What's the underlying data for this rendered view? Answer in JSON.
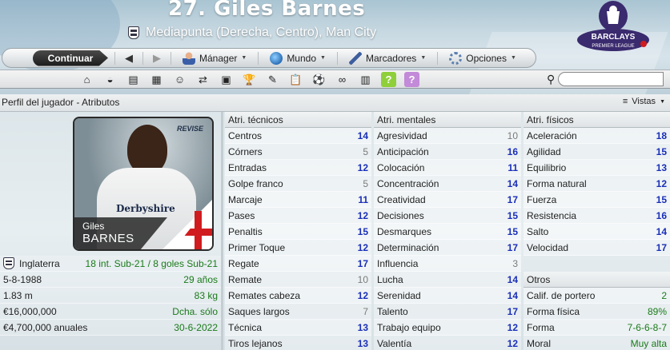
{
  "colors": {
    "value_blue": "#1a2fb8",
    "value_gray": "#7a7a7a",
    "value_green": "#1a7a1a",
    "header_text": "#ffffff"
  },
  "header": {
    "title": "27. Giles Barnes",
    "subtitle": "Mediapunta (Derecha, Centro), Man City"
  },
  "logo": {
    "text1": "BARCLAYS",
    "text2": "PREMIER LEAGUE"
  },
  "toolbar": {
    "continue_label": "Continuar",
    "back_icon": "back-arrow-icon",
    "forward_icon": "forward-arrow-icon",
    "menus": [
      {
        "label": "Mánager",
        "icon": "manager-icon"
      },
      {
        "label": "Mundo",
        "icon": "globe-icon"
      },
      {
        "label": "Marcadores",
        "icon": "bookmark-pen-icon"
      },
      {
        "label": "Opciones",
        "icon": "options-gear-icon"
      }
    ]
  },
  "icon_bar": [
    {
      "name": "home-icon",
      "glyph": "⌂"
    },
    {
      "name": "hamburger-icon",
      "glyph": "◒"
    },
    {
      "name": "inbox-icon",
      "glyph": "▤"
    },
    {
      "name": "calendar-icon",
      "glyph": "▦"
    },
    {
      "name": "squad-icon",
      "glyph": "☺"
    },
    {
      "name": "transfer-icon",
      "glyph": "⇄"
    },
    {
      "name": "tactics-board-icon",
      "glyph": "▣"
    },
    {
      "name": "trophy-icon",
      "glyph": "🏆"
    },
    {
      "name": "scout-icon",
      "glyph": "✎"
    },
    {
      "name": "clipboard-icon",
      "glyph": "📋"
    },
    {
      "name": "training-icon",
      "glyph": "⚽"
    },
    {
      "name": "binoculars-icon",
      "glyph": "∞"
    },
    {
      "name": "finance-icon",
      "glyph": "▥"
    },
    {
      "name": "help-icon",
      "glyph": "?"
    },
    {
      "name": "faq-icon",
      "glyph": "?"
    }
  ],
  "search": {
    "placeholder": "",
    "value": ""
  },
  "subheader": {
    "breadcrumb": "Perfil del jugador - Atributos",
    "views_label": "Vistas"
  },
  "player_card": {
    "first_name": "Giles",
    "last_name": "BARNES",
    "shirt_sponsor": "Derbyshire",
    "photo_tag": "REVISE"
  },
  "info": [
    {
      "label": "Inglaterra",
      "value": "18 int. Sub-21 / 8 goles Sub-21",
      "flag": true
    },
    {
      "label": "5-8-1988",
      "value": "29 años"
    },
    {
      "label": "1.83 m",
      "value": "83 kg"
    },
    {
      "label": "€16,000,000",
      "value": "Dcha. sólo"
    },
    {
      "label": "€4,700,000 anuales",
      "value": "30-6-2022"
    }
  ],
  "attributes": {
    "technical": {
      "title": "Atri. técnicos",
      "rows": [
        {
          "name": "Centros",
          "value": "14",
          "tone": "blue"
        },
        {
          "name": "Córners",
          "value": "5",
          "tone": "gray"
        },
        {
          "name": "Entradas",
          "value": "12",
          "tone": "blue"
        },
        {
          "name": "Golpe franco",
          "value": "5",
          "tone": "gray"
        },
        {
          "name": "Marcaje",
          "value": "11",
          "tone": "blue"
        },
        {
          "name": "Pases",
          "value": "12",
          "tone": "blue"
        },
        {
          "name": "Penaltis",
          "value": "15",
          "tone": "blue"
        },
        {
          "name": "Primer Toque",
          "value": "12",
          "tone": "blue"
        },
        {
          "name": "Regate",
          "value": "17",
          "tone": "blue"
        },
        {
          "name": "Remate",
          "value": "10",
          "tone": "gray"
        },
        {
          "name": "Remates cabeza",
          "value": "12",
          "tone": "blue"
        },
        {
          "name": "Saques largos",
          "value": "7",
          "tone": "gray"
        },
        {
          "name": "Técnica",
          "value": "13",
          "tone": "blue"
        },
        {
          "name": "Tiros lejanos",
          "value": "13",
          "tone": "blue"
        }
      ]
    },
    "mental": {
      "title": "Atri. mentales",
      "rows": [
        {
          "name": "Agresividad",
          "value": "10",
          "tone": "gray"
        },
        {
          "name": "Anticipación",
          "value": "16",
          "tone": "blue"
        },
        {
          "name": "Colocación",
          "value": "11",
          "tone": "blue"
        },
        {
          "name": "Concentración",
          "value": "14",
          "tone": "blue"
        },
        {
          "name": "Creatividad",
          "value": "17",
          "tone": "blue"
        },
        {
          "name": "Decisiones",
          "value": "15",
          "tone": "blue"
        },
        {
          "name": "Desmarques",
          "value": "15",
          "tone": "blue"
        },
        {
          "name": "Determinación",
          "value": "17",
          "tone": "blue"
        },
        {
          "name": "Influencia",
          "value": "3",
          "tone": "gray"
        },
        {
          "name": "Lucha",
          "value": "14",
          "tone": "blue"
        },
        {
          "name": "Serenidad",
          "value": "14",
          "tone": "blue"
        },
        {
          "name": "Talento",
          "value": "17",
          "tone": "blue"
        },
        {
          "name": "Trabajo equipo",
          "value": "12",
          "tone": "blue"
        },
        {
          "name": "Valentía",
          "value": "12",
          "tone": "blue"
        }
      ]
    },
    "physical": {
      "title": "Atri. físicos",
      "rows": [
        {
          "name": "Aceleración",
          "value": "18",
          "tone": "blue"
        },
        {
          "name": "Agilidad",
          "value": "15",
          "tone": "blue"
        },
        {
          "name": "Equilibrio",
          "value": "13",
          "tone": "blue"
        },
        {
          "name": "Forma natural",
          "value": "12",
          "tone": "blue"
        },
        {
          "name": "Fuerza",
          "value": "15",
          "tone": "blue"
        },
        {
          "name": "Resistencia",
          "value": "16",
          "tone": "blue"
        },
        {
          "name": "Salto",
          "value": "14",
          "tone": "blue"
        },
        {
          "name": "Velocidad",
          "value": "17",
          "tone": "blue"
        }
      ]
    },
    "other": {
      "title": "Otros",
      "rows": [
        {
          "name": "Calif. de portero",
          "value": "2",
          "tone": "green"
        },
        {
          "name": "Forma física",
          "value": "89%",
          "tone": "green"
        },
        {
          "name": "Forma",
          "value": "7-6-6-8-7",
          "tone": "green"
        },
        {
          "name": "Moral",
          "value": "Muy alta",
          "tone": "green"
        }
      ]
    }
  }
}
